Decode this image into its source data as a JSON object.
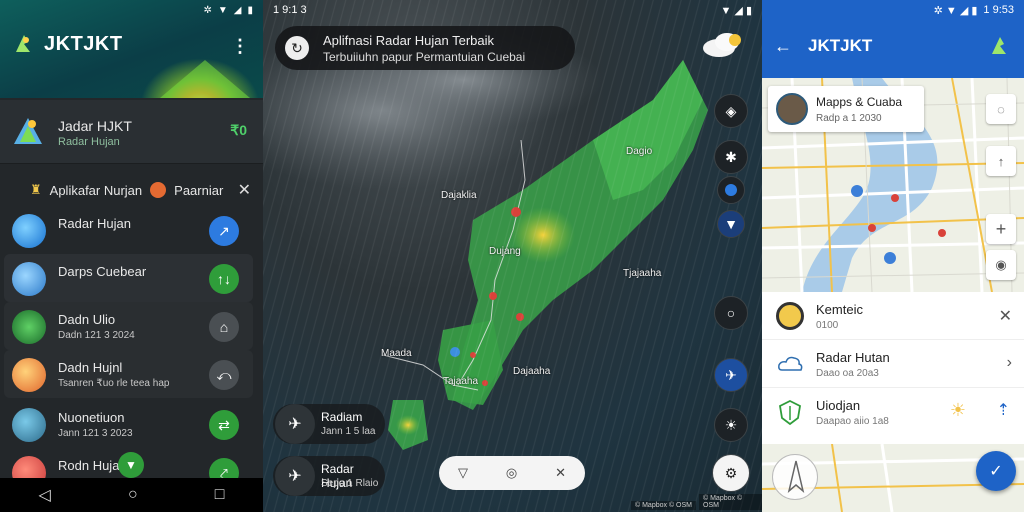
{
  "left": {
    "status": {
      "icons": [
        "settings-icon",
        "wifi-icon",
        "signal-icon",
        "battery-icon"
      ],
      "time": ""
    },
    "app_title": "JKTJKT",
    "account": {
      "name": "Jadar HJKT",
      "sub": "Radar Hujan",
      "tag": "₹0"
    },
    "notice": {
      "text1": "Aplikafar Nurjan",
      "text2": "Paarniar"
    },
    "items": [
      {
        "title": "Radar Hujan",
        "sub": "",
        "btn": "↗"
      },
      {
        "title": "Darps Cuebear",
        "sub": "",
        "btn": "↑↓"
      },
      {
        "title": "Dadn Ulio",
        "sub": "Dadn 121 3 2024",
        "btn": "⌂"
      },
      {
        "title": "Dadn Hujnl",
        "sub": "Tsanren ₹uo rle teea hap",
        "btn": "⤺"
      },
      {
        "title": "Nuonetiuon",
        "sub": "Jann 121 3 2023",
        "btn": "⇄"
      },
      {
        "title": "Rodn Hujan",
        "sub": "",
        "btn": "⤤"
      }
    ],
    "nav": [
      "◁",
      "○",
      "□"
    ]
  },
  "middle": {
    "status": {
      "time": "1 9:1 3"
    },
    "banner": {
      "line1": "Aplifnasi Radar Hujan Terbaik",
      "line2": "Terbuiiuhn papur Permantuian Cuebai"
    },
    "cities": [
      {
        "name": "Dagio"
      },
      {
        "name": "Dajaklia"
      },
      {
        "name": "Dujang"
      },
      {
        "name": "Tjajaaha"
      },
      {
        "name": "Maada"
      },
      {
        "name": "Tajaaha"
      },
      {
        "name": "Dajaaha"
      }
    ],
    "layers": [
      {
        "title": "Radiam",
        "sub": "Jann 1 5 laa"
      },
      {
        "title": "Radar Hujan",
        "sub": "Sepo 1 Rlaio"
      }
    ],
    "credits": [
      "© Mapbox © OSM",
      "© Mapbox © OSM"
    ]
  },
  "right": {
    "status": {
      "time": "1 9:53"
    },
    "app_title": "JKTJKT",
    "place": {
      "title": "Mapps & Cuaba",
      "sub": "Radp a 1 2030"
    },
    "sheet": [
      {
        "title": "Kemteic",
        "sub": "0100",
        "right": "✕"
      },
      {
        "title": "Radar Hutan",
        "sub": "Daao oa 20a3",
        "right": "›"
      },
      {
        "title": "Uiodjan",
        "sub": "Daapao aiio 1a8",
        "right": ""
      }
    ]
  }
}
